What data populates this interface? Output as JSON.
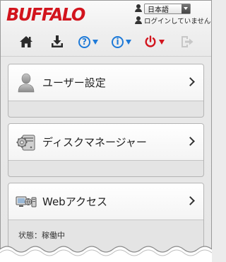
{
  "header": {
    "logo_text": "BUFFALO",
    "language": {
      "selected": "日本語"
    },
    "login_status": "ログインしていません"
  },
  "toolbar": {
    "icons": [
      "home-icon",
      "download-icon",
      "help-icon",
      "info-icon",
      "power-icon",
      "logout-icon"
    ]
  },
  "cards": [
    {
      "title": "ユーザー設定",
      "icon": "user-icon",
      "status": ""
    },
    {
      "title": "ディスクマネージャー",
      "icon": "disk-settings-icon",
      "status": ""
    },
    {
      "title": "Webアクセス",
      "icon": "web-access-icon",
      "status": "状態：稼働中"
    }
  ],
  "colors": {
    "brand": "#d2141d",
    "accent": "#1e7ad8"
  }
}
